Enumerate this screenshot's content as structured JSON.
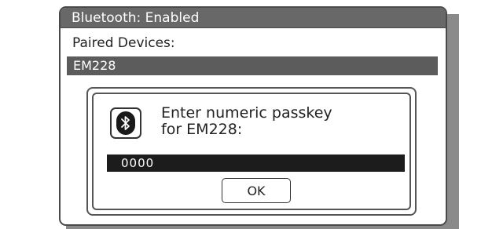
{
  "window": {
    "title": "Bluetooth: Enabled"
  },
  "paired": {
    "label": "Paired Devices:",
    "selected_device": "EM228"
  },
  "dialog": {
    "icon": "bluetooth-icon",
    "prompt_line1": "Enter numeric passkey",
    "prompt_line2": "for EM228:",
    "passkey_value": "0000",
    "ok_label": "OK"
  },
  "colors": {
    "titlebar": "#686868",
    "selected_row": "#5c5c5c",
    "passkey_field": "#1c1c1c",
    "border": "#4a4a4a"
  }
}
